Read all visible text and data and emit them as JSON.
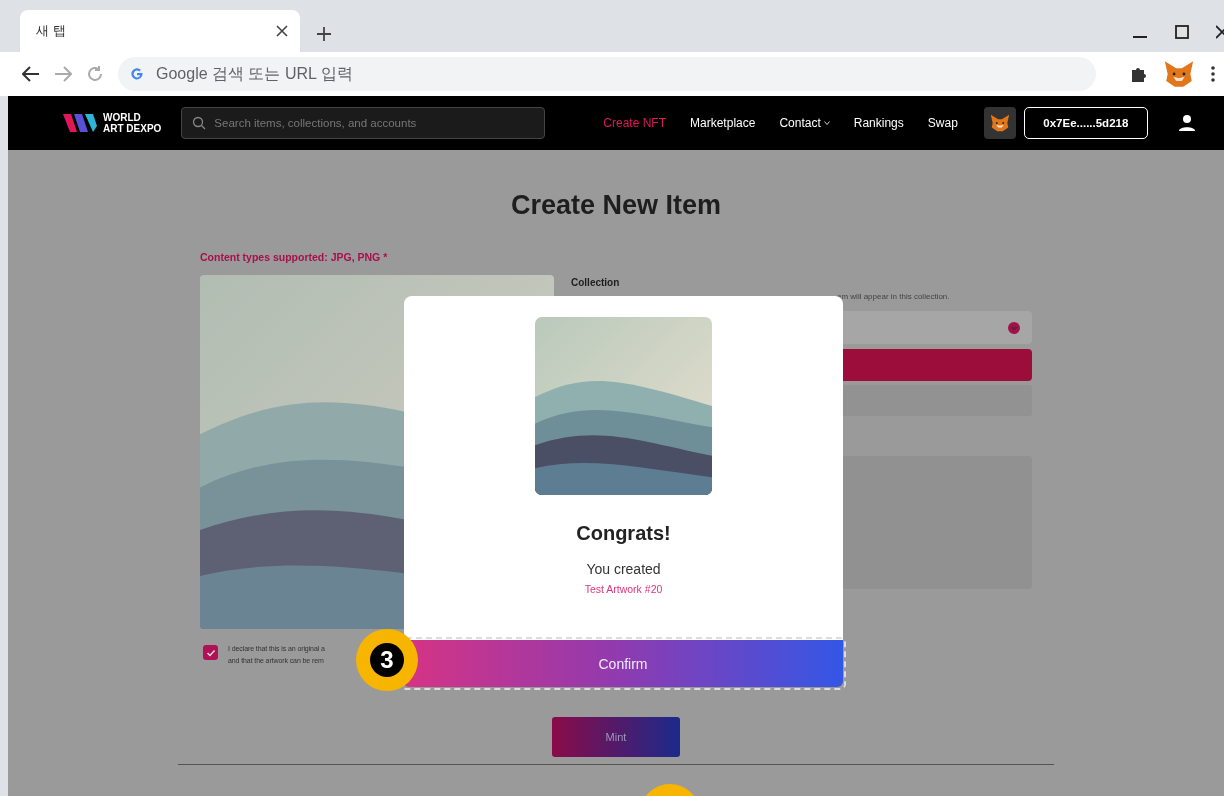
{
  "browser": {
    "tabs": [
      {
        "label": "새 탭",
        "selected": true
      }
    ],
    "address_bar": {
      "placeholder": "Google 검색 또는 URL 입력"
    }
  },
  "site_nav": {
    "logo": [
      "WORLD",
      "ART DEXPO"
    ],
    "search": {
      "placeholder": "Search items, collections, and accounts"
    },
    "links": [
      {
        "label": "Create NFT",
        "selected": true,
        "has_menu": false
      },
      {
        "label": "Marketplace",
        "selected": false,
        "has_menu": false
      },
      {
        "label": "Contact",
        "selected": false,
        "has_menu": true
      },
      {
        "label": "Rankings",
        "selected": false,
        "has_menu": false
      },
      {
        "label": "Swap",
        "selected": false,
        "has_menu": false
      }
    ],
    "wallet_address": "0x7Ee......5d218"
  },
  "page": {
    "title": "Create New Item",
    "content_types": "Content types supported: JPG, PNG *",
    "collection_label": "Collection",
    "collection_hint": "em will appear in this collection.",
    "declaration": {
      "checked": true,
      "lines": [
        "I declare that this is an original a",
        "and that the artwork can be rem"
      ]
    },
    "mint_button": "Mint"
  },
  "modal": {
    "title": "Congrats!",
    "message": "You created",
    "item_name": "Test Artwork #20",
    "confirm_button": "Confirm"
  },
  "step_marker": "3"
}
